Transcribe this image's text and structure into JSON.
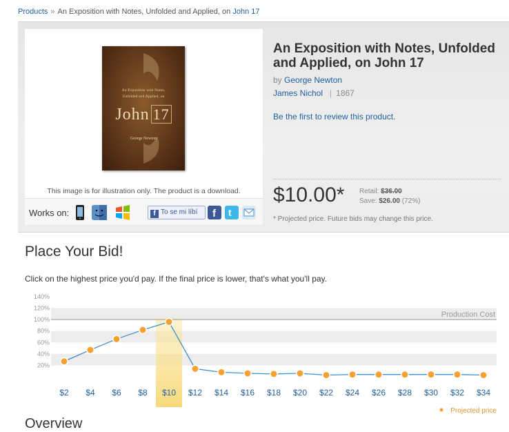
{
  "breadcrumb": {
    "root": "Products",
    "separator": "»",
    "item_prefix": "An Exposition with Notes, Unfolded and Applied, on",
    "item_link": "John 17"
  },
  "cover": {
    "subtitle_line1": "An Exposition with Notes,",
    "subtitle_line2": "Unfolded and Applied, on",
    "title_word": "John",
    "title_number": "17",
    "author": "George Newton"
  },
  "image_note": "This image is for illustration only. The product is a download.",
  "works_on": {
    "label": "Works on:",
    "devices": [
      "phone-icon",
      "mac-icon",
      "windows-icon"
    ]
  },
  "social": {
    "fb_like_label": "To se mi líbí",
    "share_icons": [
      "facebook-icon",
      "twitter-icon",
      "email-icon"
    ]
  },
  "product": {
    "title": "An Exposition with Notes, Unfolded and Applied, on John 17",
    "by_label": "by",
    "author": "George Newton",
    "publisher": "James Nichol",
    "year": "1867",
    "review_link": "Be the first to review this product.",
    "price": "$10.00*",
    "retail_label": "Retail:",
    "retail_value": "$36.00",
    "save_label": "Save:",
    "save_value": "$26.00",
    "save_pct": "(72%)",
    "projected_note": "* Projected price. Future bids may change this price."
  },
  "bid": {
    "heading": "Place Your Bid!",
    "instruction": "Click on the highest price you'd pay. If the final price is lower, that's what you'll pay."
  },
  "colors": {
    "link": "#1e5e9e",
    "point": "#f6a030",
    "line": "#3a8fd0",
    "highlight": "#f9d97a"
  },
  "chart_data": {
    "type": "line",
    "categories": [
      "$2",
      "$4",
      "$6",
      "$8",
      "$10",
      "$12",
      "$14",
      "$16",
      "$18",
      "$20",
      "$22",
      "$24",
      "$26",
      "$28",
      "$30",
      "$32",
      "$34"
    ],
    "series": [
      {
        "name": "Projected price",
        "values": [
          27,
          47,
          66,
          82,
          96,
          14,
          8,
          6,
          5,
          6,
          3,
          4,
          4,
          4,
          4,
          4,
          3
        ]
      }
    ],
    "y_ticks": [
      "20%",
      "40%",
      "60%",
      "80%",
      "100%",
      "120%",
      "140%"
    ],
    "ylim": [
      0,
      140
    ],
    "reference_line": {
      "value": 100,
      "label": "Production Cost"
    },
    "selected_category": "$10",
    "legend": "Projected price",
    "legend_position": "bottom-right"
  },
  "overview_heading": "Overview"
}
